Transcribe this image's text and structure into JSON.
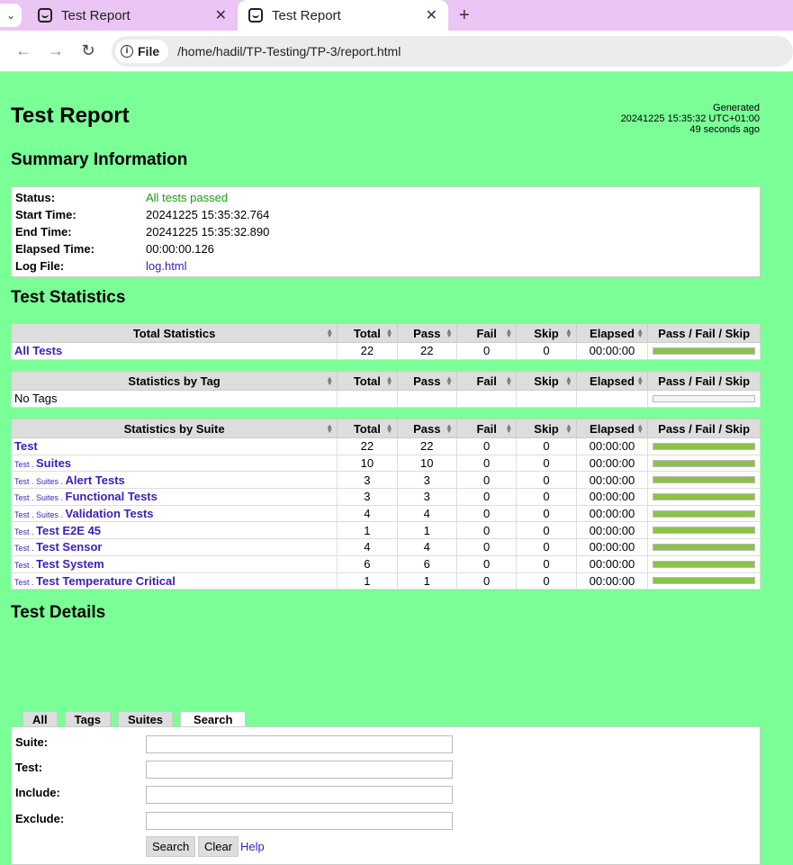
{
  "browser": {
    "tabs": [
      {
        "title": "Test Report",
        "active": false
      },
      {
        "title": "Test Report",
        "active": true
      }
    ],
    "chip_label": "File",
    "url": "/home/hadil/TP-Testing/TP-3/report.html"
  },
  "report": {
    "title": "Test Report",
    "generated_label": "Generated",
    "generated_time": "20241225 15:35:32 UTC+01:00",
    "generated_ago": "49 seconds ago",
    "summary_heading": "Summary Information",
    "summary": [
      {
        "label": "Status:",
        "value": "All tests passed"
      },
      {
        "label": "Start Time:",
        "value": "20241225 15:35:32.764"
      },
      {
        "label": "End Time:",
        "value": "20241225 15:35:32.890"
      },
      {
        "label": "Elapsed Time:",
        "value": "00:00:00.126"
      },
      {
        "label": "Log File:",
        "value": "log.html"
      }
    ],
    "stats_heading": "Test Statistics",
    "columns": [
      "Total",
      "Pass",
      "Fail",
      "Skip",
      "Elapsed",
      "Pass / Fail / Skip"
    ],
    "total_stats": {
      "header": "Total Statistics",
      "rows": [
        {
          "name": "All Tests",
          "total": "22",
          "pass": "22",
          "fail": "0",
          "skip": "0",
          "elapsed": "00:00:00",
          "pass_ratio": 1
        }
      ]
    },
    "tag_stats": {
      "header": "Statistics by Tag",
      "rows": [
        {
          "name": "No Tags",
          "total": "",
          "pass": "",
          "fail": "",
          "skip": "",
          "elapsed": "",
          "pass_ratio": 0
        }
      ]
    },
    "suite_stats": {
      "header": "Statistics by Suite",
      "rows": [
        {
          "prefix": "",
          "name": "Test",
          "total": "22",
          "pass": "22",
          "fail": "0",
          "skip": "0",
          "elapsed": "00:00:00",
          "pass_ratio": 1
        },
        {
          "prefix": "Test . ",
          "name": "Suites",
          "total": "10",
          "pass": "10",
          "fail": "0",
          "skip": "0",
          "elapsed": "00:00:00",
          "pass_ratio": 1
        },
        {
          "prefix": "Test . Suites . ",
          "name": "Alert Tests",
          "total": "3",
          "pass": "3",
          "fail": "0",
          "skip": "0",
          "elapsed": "00:00:00",
          "pass_ratio": 1
        },
        {
          "prefix": "Test . Suites . ",
          "name": "Functional Tests",
          "total": "3",
          "pass": "3",
          "fail": "0",
          "skip": "0",
          "elapsed": "00:00:00",
          "pass_ratio": 1
        },
        {
          "prefix": "Test . Suites . ",
          "name": "Validation Tests",
          "total": "4",
          "pass": "4",
          "fail": "0",
          "skip": "0",
          "elapsed": "00:00:00",
          "pass_ratio": 1
        },
        {
          "prefix": "Test . ",
          "name": "Test E2E 45",
          "total": "1",
          "pass": "1",
          "fail": "0",
          "skip": "0",
          "elapsed": "00:00:00",
          "pass_ratio": 1
        },
        {
          "prefix": "Test . ",
          "name": "Test Sensor",
          "total": "4",
          "pass": "4",
          "fail": "0",
          "skip": "0",
          "elapsed": "00:00:00",
          "pass_ratio": 1
        },
        {
          "prefix": "Test . ",
          "name": "Test System",
          "total": "6",
          "pass": "6",
          "fail": "0",
          "skip": "0",
          "elapsed": "00:00:00",
          "pass_ratio": 1
        },
        {
          "prefix": "Test . ",
          "name": "Test Temperature Critical",
          "total": "1",
          "pass": "1",
          "fail": "0",
          "skip": "0",
          "elapsed": "00:00:00",
          "pass_ratio": 1
        }
      ]
    },
    "details_heading": "Test Details",
    "detail_tabs": [
      "All",
      "Tags",
      "Suites",
      "Search"
    ],
    "active_detail_tab": "Search",
    "search_fields": [
      {
        "label": "Suite:",
        "value": ""
      },
      {
        "label": "Test:",
        "value": ""
      },
      {
        "label": "Include:",
        "value": ""
      },
      {
        "label": "Exclude:",
        "value": ""
      }
    ],
    "search_button": "Search",
    "clear_button": "Clear",
    "help_link": "Help"
  },
  "colors": {
    "background": "#7bff97",
    "pass_text": "#1a9a1a",
    "link": "#3b1fb8",
    "bar_pass": "#8bc34a",
    "tabbar": "#ebc5f3"
  }
}
